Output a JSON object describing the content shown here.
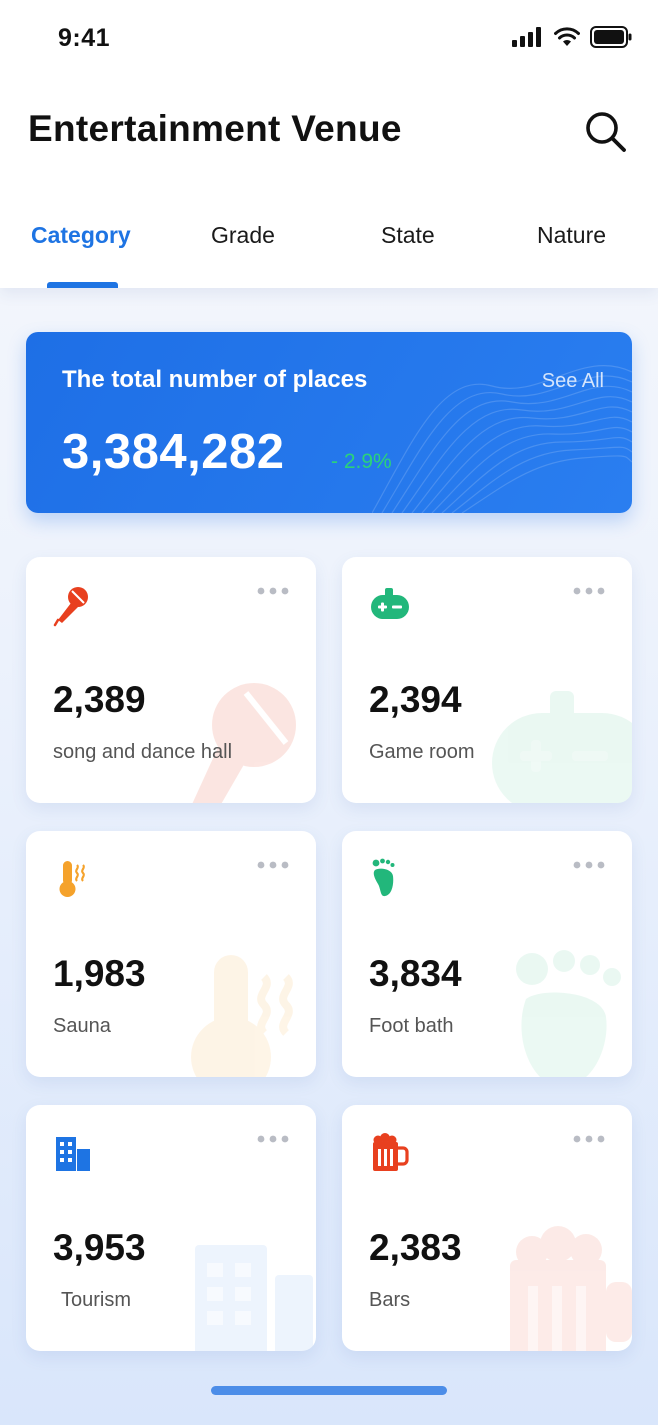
{
  "status_bar": {
    "time": "9:41"
  },
  "header": {
    "title": "Entertainment Venue"
  },
  "tabs": [
    {
      "label": "Category",
      "active": true
    },
    {
      "label": "Grade",
      "active": false
    },
    {
      "label": "State",
      "active": false
    },
    {
      "label": "Nature",
      "active": false
    }
  ],
  "summary": {
    "label": "The total number of places",
    "see_all": "See All",
    "total": "3,384,282",
    "change": "- 2.9%"
  },
  "categories": [
    {
      "value": "2,389",
      "label": "song and dance hall",
      "icon": "microphone-icon",
      "color": "#e8401f"
    },
    {
      "value": "2,394",
      "label": "Game room",
      "icon": "gamepad-icon",
      "color": "#22b77b"
    },
    {
      "value": "1,983",
      "label": "Sauna",
      "icon": "thermometer-icon",
      "color": "#f5a22b"
    },
    {
      "value": "3,834",
      "label": "Foot bath",
      "icon": "footprint-icon",
      "color": "#22b77b"
    },
    {
      "value": "3,953",
      "label": "Tourism",
      "icon": "building-icon",
      "color": "#1e74e3"
    },
    {
      "value": "2,383",
      "label": "Bars",
      "icon": "beer-mug-icon",
      "color": "#e8401f"
    }
  ],
  "colors": {
    "accent": "#1e74e3",
    "positive": "#2bd27a"
  }
}
